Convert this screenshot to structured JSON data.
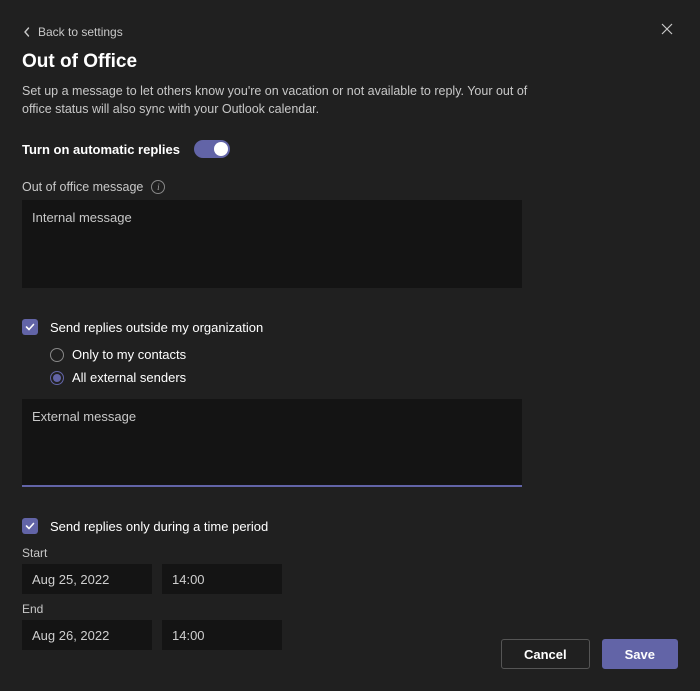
{
  "header": {
    "back_label": "Back to settings",
    "title": "Out of Office",
    "description": "Set up a message to let others know you're on vacation or not available to reply. Your out of office status will also sync with your Outlook calendar."
  },
  "toggle": {
    "label": "Turn on automatic replies",
    "on": true
  },
  "internal": {
    "label": "Out of office message",
    "value": "Internal message"
  },
  "external": {
    "checkbox_label": "Send replies outside my organization",
    "checked": true,
    "options": {
      "contacts": "Only to my contacts",
      "all": "All external senders",
      "selected": "all"
    },
    "value": "External message"
  },
  "schedule": {
    "checkbox_label": "Send replies only during a time period",
    "checked": true,
    "start_label": "Start",
    "start_date": "Aug 25, 2022",
    "start_time": "14:00",
    "end_label": "End",
    "end_date": "Aug 26, 2022",
    "end_time": "14:00"
  },
  "footer": {
    "cancel": "Cancel",
    "save": "Save"
  },
  "colors": {
    "accent": "#6264a7",
    "background": "#202020",
    "input_bg": "#141414"
  }
}
